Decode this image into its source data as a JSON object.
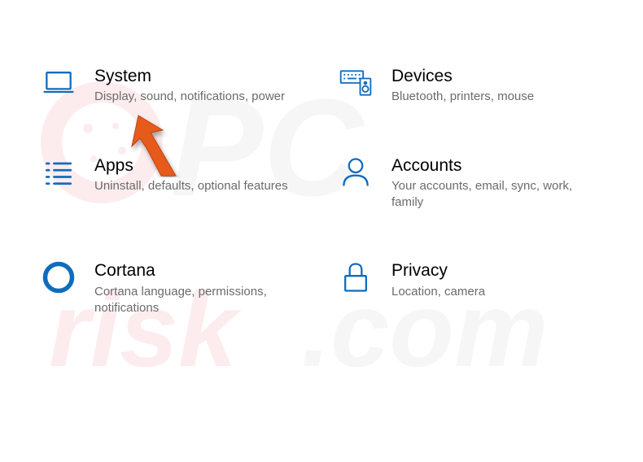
{
  "colors": {
    "iconBlue": "#0F6CBD",
    "titleText": "#000000",
    "subtitleText": "#6b6b6b",
    "cursorOrange": "#E65A1E"
  },
  "settings": {
    "items": [
      {
        "key": "system",
        "title": "System",
        "subtitle": "Display, sound, notifications, power",
        "icon": "laptop-icon"
      },
      {
        "key": "devices",
        "title": "Devices",
        "subtitle": "Bluetooth, printers, mouse",
        "icon": "keyboard-speaker-icon"
      },
      {
        "key": "apps",
        "title": "Apps",
        "subtitle": "Uninstall, defaults, optional features",
        "icon": "list-icon"
      },
      {
        "key": "accounts",
        "title": "Accounts",
        "subtitle": "Your accounts, email, sync, work, family",
        "icon": "person-icon"
      },
      {
        "key": "cortana",
        "title": "Cortana",
        "subtitle": "Cortana language, permissions, notifications",
        "icon": "cortana-circle-icon"
      },
      {
        "key": "privacy",
        "title": "Privacy",
        "subtitle": "Location, camera",
        "icon": "lock-icon"
      }
    ]
  },
  "watermarkText": "PCrisk.com"
}
